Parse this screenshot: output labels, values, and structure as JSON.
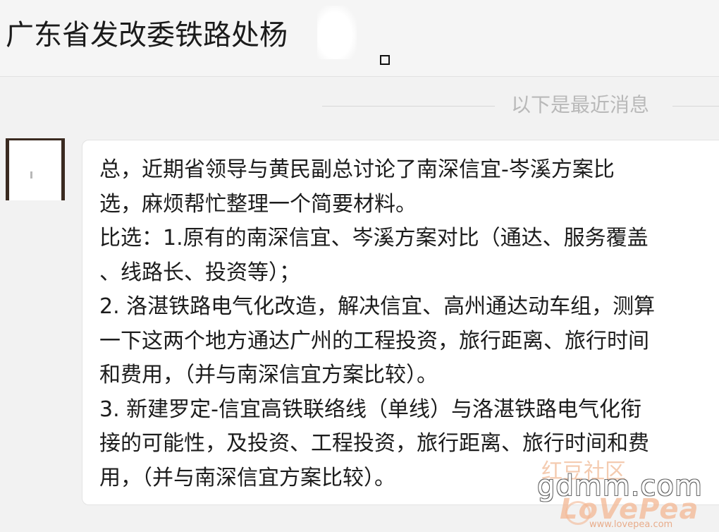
{
  "header": {
    "title": "广东省发改委铁路处杨",
    "window_button_icon": "restore-square-icon"
  },
  "divider": {
    "label": "以下是最近消息"
  },
  "message": {
    "lines": [
      "总，近期省领导与黄民副总讨论了南深信宜-岑溪方案比",
      "选，麻烦帮忙整理一个简要材料。",
      "比选：1.原有的南深信宜、岑溪方案对比（通达、服务覆盖",
      "、线路长、投资等）；",
      "2. 洛湛铁路电气化改造，解决信宜、高州通达动车组，测算",
      "一下这两个地方通达广州的工程投资，旅行距离、旅行时间",
      "和费用，（并与南深信宜方案比较）。",
      "3. 新建罗定-信宜高铁联络线（单线）与洛湛铁路电气化衔",
      "接的可能性，及投资、工程投资，旅行距离、旅行时间和费",
      "用，（并与南深信宜方案比较）。"
    ]
  },
  "watermark": {
    "site": "gdmm.com",
    "forum": "红豆社区",
    "brand": "LoVePea",
    "url": "www.lovepea.com"
  },
  "colors": {
    "background": "#f2f2f2",
    "bubble": "#ffffff",
    "divider_text": "#b9b9b9",
    "text": "#1c1c1c"
  }
}
